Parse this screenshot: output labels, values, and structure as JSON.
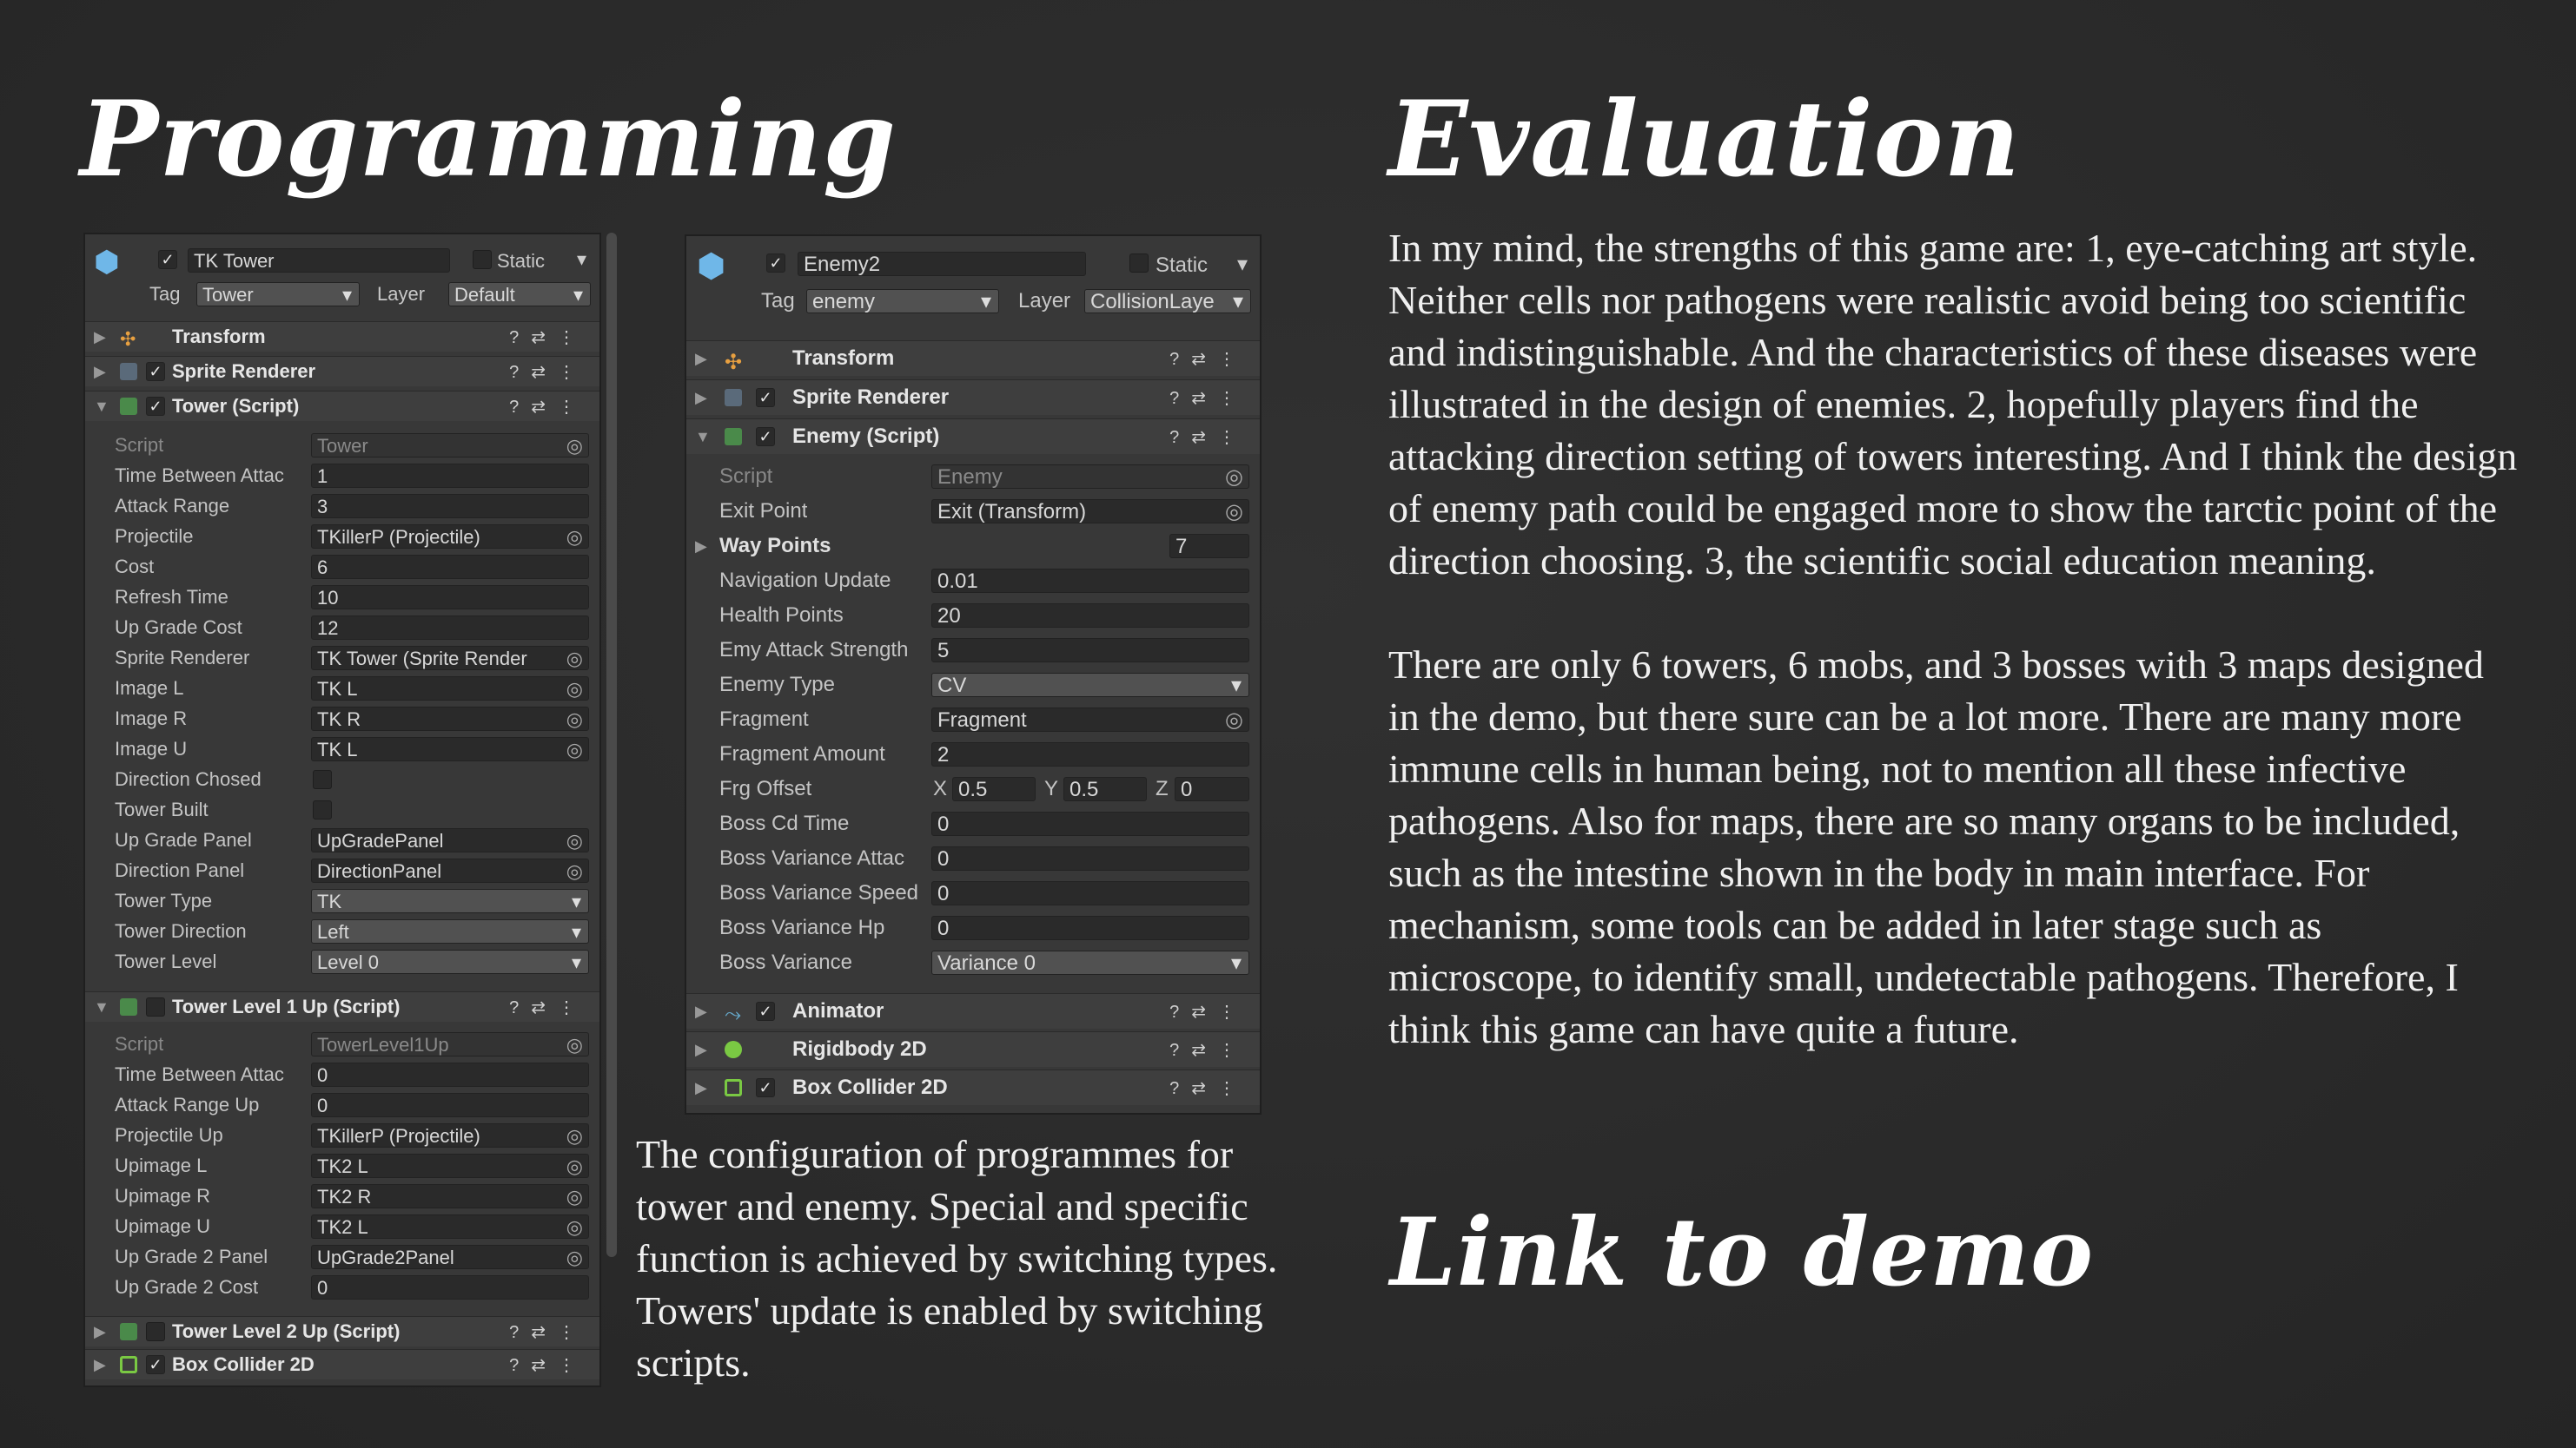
{
  "headings": {
    "programming": "Programming",
    "evaluation": "Evaluation",
    "link": "Link to demo"
  },
  "evaluation_paragraphs": [
    "In my mind, the strengths of this game are: 1, eye-catching art style. Neither cells nor pathogens were realistic avoid being too scientific and indistinguishable. And the characteristics of these diseases were illustrated in the design of enemies. 2, hopefully players find the attacking direction setting of towers interesting. And I think the design of enemy path could be engaged more to show the tarctic point of the direction choosing. 3, the scientific social education meaning.",
    "There are only 6 towers, 6 mobs, and 3 bosses with 3 maps designed in the demo, but there sure can be a lot more. There are many more immune cells in human being, not to mention all these infective pathogens. Also for maps, there are so many organs to be included, such as the intestine shown in the body in main interface. For mechanism, some tools can be added in later stage such as microscope, to identify small, undetectable pathogens. Therefore, I think this game can have quite a future."
  ],
  "caption": "The configuration of programmes for tower and enemy. Special and specific function is achieved by switching types. Towers' update is enabled by switching scripts.",
  "tower_panel": {
    "name": "TK Tower",
    "static": "Static",
    "tag_label": "Tag",
    "tag": "Tower",
    "layer_label": "Layer",
    "layer": "Default",
    "components": {
      "transform": "Transform",
      "sprite_renderer": "Sprite Renderer",
      "tower_script": "Tower (Script)"
    },
    "fields": [
      {
        "label": "Script",
        "value": "Tower"
      },
      {
        "label": "Time Between Attac",
        "value": "1"
      },
      {
        "label": "Attack Range",
        "value": "3"
      },
      {
        "label": "Projectile",
        "value": "TKillerP (Projectile)"
      },
      {
        "label": "Cost",
        "value": "6"
      },
      {
        "label": "Refresh Time",
        "value": "10"
      },
      {
        "label": "Up Grade Cost",
        "value": "12"
      },
      {
        "label": "Sprite Renderer",
        "value": "TK Tower (Sprite Render"
      },
      {
        "label": "Image L",
        "value": "TK L"
      },
      {
        "label": "Image R",
        "value": "TK R"
      },
      {
        "label": "Image U",
        "value": "TK L"
      },
      {
        "label": "Direction Chosed",
        "value": ""
      },
      {
        "label": "Tower Built",
        "value": ""
      },
      {
        "label": "Up Grade Panel",
        "value": "UpGradePanel"
      },
      {
        "label": "Direction Panel",
        "value": "DirectionPanel"
      },
      {
        "label": "Tower Type",
        "value": "TK"
      },
      {
        "label": "Tower Direction",
        "value": "Left"
      },
      {
        "label": "Tower Level",
        "value": "Level 0"
      }
    ],
    "level1_title": "Tower Level 1 Up (Script)",
    "level1_fields": [
      {
        "label": "Script",
        "value": "TowerLevel1Up"
      },
      {
        "label": "Time Between Attac",
        "value": "0"
      },
      {
        "label": "Attack Range Up",
        "value": "0"
      },
      {
        "label": "Projectile Up",
        "value": "TKillerP (Projectile)"
      },
      {
        "label": "Upimage L",
        "value": "TK2 L"
      },
      {
        "label": "Upimage R",
        "value": "TK2 R"
      },
      {
        "label": "Upimage U",
        "value": "TK2 L"
      },
      {
        "label": "Up Grade 2 Panel",
        "value": "UpGrade2Panel"
      },
      {
        "label": "Up Grade 2 Cost",
        "value": "0"
      }
    ],
    "level2_title": "Tower Level 2 Up (Script)",
    "box_collider": "Box Collider 2D"
  },
  "enemy_panel": {
    "name": "Enemy2",
    "static": "Static",
    "tag_label": "Tag",
    "tag": "enemy",
    "layer_label": "Layer",
    "layer": "CollisionLaye",
    "components": {
      "transform": "Transform",
      "sprite_renderer": "Sprite Renderer",
      "enemy_script": "Enemy (Script)"
    },
    "fields": [
      {
        "label": "Script",
        "value": "Enemy"
      },
      {
        "label": "Exit Point",
        "value": "Exit (Transform)"
      },
      {
        "label": "Way Points",
        "value": "7"
      },
      {
        "label": "Navigation Update",
        "value": "0.01"
      },
      {
        "label": "Health Points",
        "value": "20"
      },
      {
        "label": "Emy Attack Strength",
        "value": "5"
      },
      {
        "label": "Enemy Type",
        "value": "CV"
      },
      {
        "label": "Fragment",
        "value": "Fragment"
      },
      {
        "label": "Fragment Amount",
        "value": "2"
      },
      {
        "label": "Frg Offset",
        "value": ""
      },
      {
        "label": "Boss Cd Time",
        "value": "0"
      },
      {
        "label": "Boss Variance Attac",
        "value": "0"
      },
      {
        "label": "Boss Variance Speed",
        "value": "0"
      },
      {
        "label": "Boss Variance Hp",
        "value": "0"
      },
      {
        "label": "Boss Variance",
        "value": "Variance 0"
      }
    ],
    "frg_offset": {
      "x_label": "X",
      "x": "0.5",
      "y_label": "Y",
      "y": "0.5",
      "z_label": "Z",
      "z": "0"
    },
    "tail_components": {
      "animator": "Animator",
      "rigidbody": "Rigidbody 2D",
      "box_collider": "Box Collider 2D"
    }
  }
}
